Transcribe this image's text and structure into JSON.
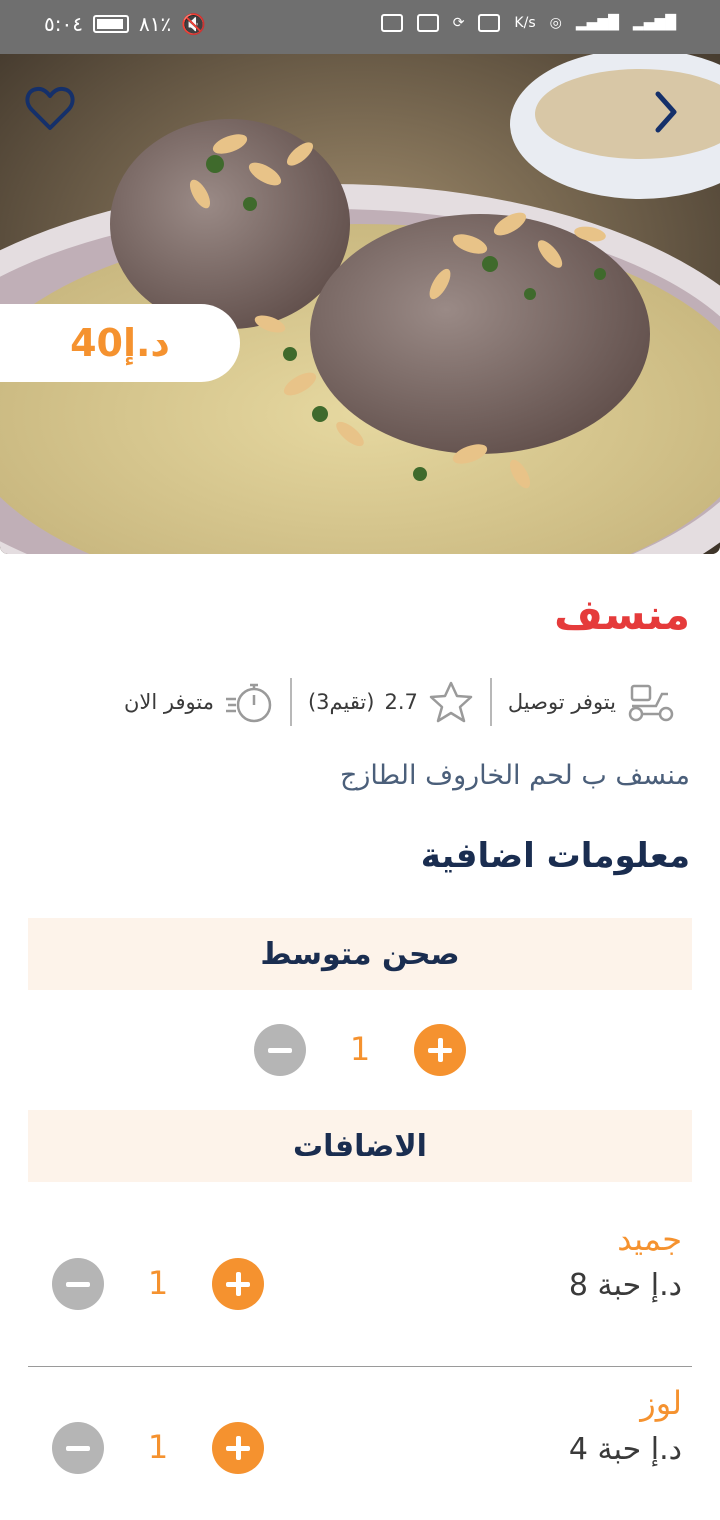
{
  "status_bar": {
    "time": "٥:٠٤",
    "battery": "٨١٪",
    "net_speed": "K/s"
  },
  "item": {
    "price": "40د.إ",
    "name": "منسف",
    "delivery": "يتوفر توصيل",
    "rating": "2.7",
    "rating_count": "(3تقيم)",
    "availability": "متوفر الان",
    "description": "منسف ب لحم الخاروف الطازج"
  },
  "extra_info": {
    "title": "معلومات اضافية",
    "size_label": "صحن متوسط",
    "size_qty": "1",
    "addons_label": "الاضافات",
    "addons": [
      {
        "name": "جميد",
        "price": "8 د.إ حبة",
        "qty": "1"
      },
      {
        "name": "لوز",
        "price": "4 د.إ حبة",
        "qty": "1"
      }
    ]
  },
  "icons": {
    "favorite": "heart-outline-icon",
    "next": "chevron-right-icon",
    "delivery": "scooter-icon",
    "rating": "star-icon",
    "availability": "stopwatch-icon"
  },
  "colors": {
    "accent": "#f5922f",
    "title_red": "#e53b3b",
    "navy": "#1a2d50",
    "band": "#fdf3ea"
  }
}
